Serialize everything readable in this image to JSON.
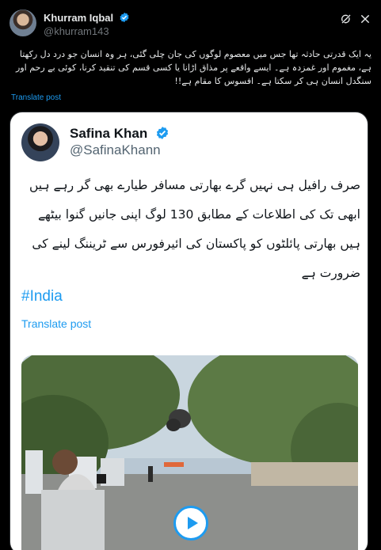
{
  "post": {
    "author": {
      "name": "Khurram Iqbal",
      "handle": "@khurram143"
    },
    "text": "یہ ایک قدرتی حادثہ تھا جس میں معصوم لوگوں کی جان چلی گئی، ہر وہ انسان جو درد دل رکھتا ہے، مغموم اور غمزدہ ہے۔ ایسے واقعے پر مذاق اڑانا یا کسی قسم کی تنقید کرنا، کوئی بے رحم اور سنگدل انسان ہی کر سکتا ہے۔ افسوس کا مقام ہے!!",
    "translate_label": "Translate post"
  },
  "quote": {
    "author": {
      "name": "Safina Khan",
      "handle": "@SafinaKhann"
    },
    "text": "صرف رافیل ہی نہیں گرے بھارتی مسافر طیارے بھی گر رہے ہیں ابھی تک کی اطلاعات کے مطابق 130 لوگ اپنی جانیں گنوا بیٹھے ہیں بھارتی پائلٹوں کو پاکستان کی ائیرفورس سے ٹریننگ لینے کی ضرورت ہے",
    "hashtag": "#India",
    "translate_label": "Translate post",
    "media": {
      "type": "video"
    }
  },
  "icons": {
    "verified": "verified-badge-icon",
    "grok": "grok-icon",
    "close": "close-icon",
    "play": "play-icon"
  },
  "colors": {
    "accent": "#1d9bf0",
    "background": "#000000",
    "card": "#ffffff",
    "muted": "#71767b"
  }
}
